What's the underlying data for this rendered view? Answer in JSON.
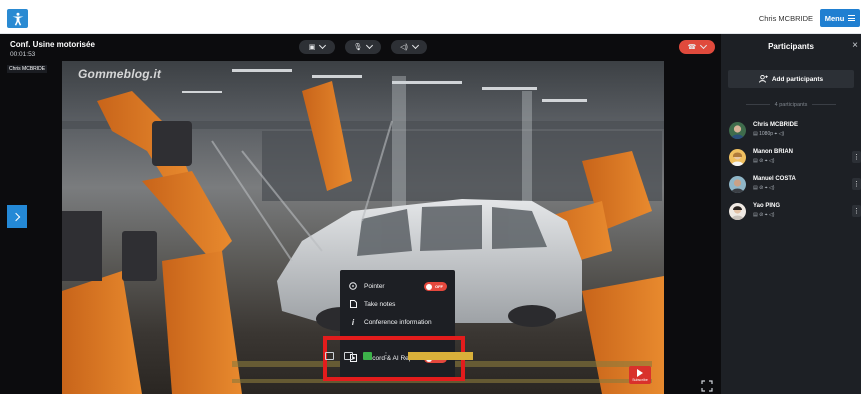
{
  "topbar": {
    "logo_icon": "accessibility-icon",
    "username": "Chris MCBRIDE",
    "menu_label": "Menu"
  },
  "conference": {
    "title": "Conf. Usine motorisée",
    "timer": "00:01:53",
    "self_label": "Chris MCBRIDE",
    "watermark": "Gommeblog.it",
    "controls": [
      {
        "name": "camera",
        "icon": "camera-icon"
      },
      {
        "name": "microphone",
        "icon": "microphone-icon"
      },
      {
        "name": "speaker",
        "icon": "speaker-icon"
      },
      {
        "name": "hangup",
        "icon": "phone-icon",
        "color": "#e04a3c"
      }
    ]
  },
  "popup_menu": {
    "items": [
      {
        "label": "Pointer",
        "icon": "target-icon",
        "toggle": "OFF"
      },
      {
        "label": "Take notes",
        "icon": "note-icon"
      },
      {
        "label": "Conference information",
        "icon": "info-icon"
      },
      {
        "label": "Record & AI Report",
        "icon": "record-icon",
        "toggle": "OFF"
      }
    ],
    "highlight_color": "#e31c1c"
  },
  "youtube": {
    "label": "Subscribe"
  },
  "panel": {
    "title": "Participants",
    "close": "×",
    "add_label": "Add participants",
    "count_label": "4 participants",
    "participants": [
      {
        "name": "Chris MCBRIDE",
        "status": "▤ 1080p ⌖ ◁)"
      },
      {
        "name": "Manon BRIAN",
        "status": "▤ ⊘ ⌖ ◁)"
      },
      {
        "name": "Manuel COSTA",
        "status": "▤ ⊘ ⌖ ◁)"
      },
      {
        "name": "Yao PING",
        "status": "▤ ⊘ ⌖ ◁)"
      }
    ]
  },
  "colors": {
    "accent": "#1f7fd1",
    "panel_bg": "#1d2025",
    "toggle_off": "#e5483d"
  }
}
